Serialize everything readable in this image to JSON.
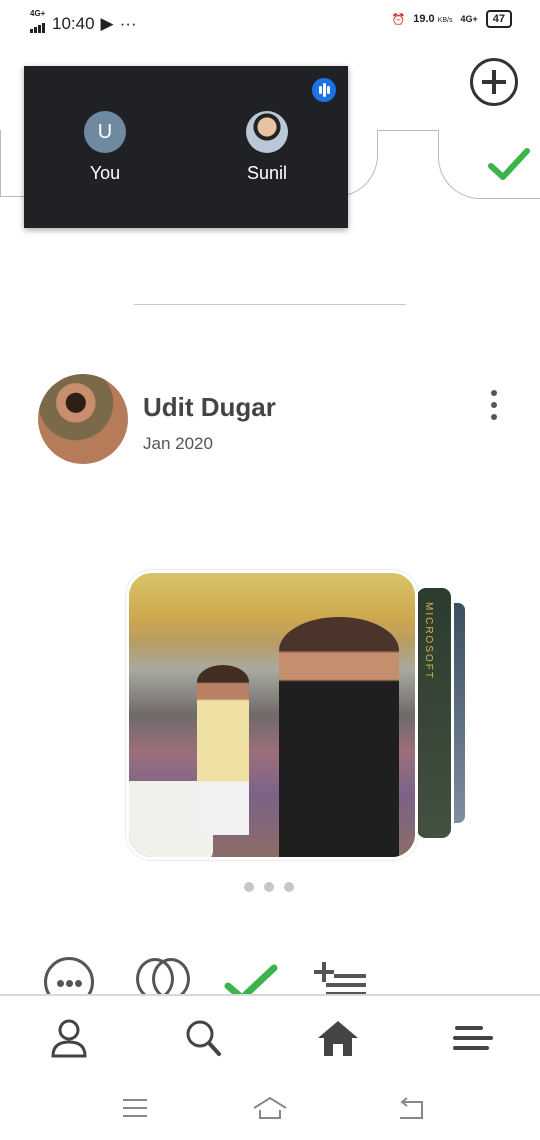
{
  "status_bar": {
    "network_left": "4G+",
    "time": "10:40",
    "speed": "19.0",
    "speed_unit": "KB/s",
    "network_right": "4G+",
    "battery": "47"
  },
  "call_overlay": {
    "participants": [
      {
        "initial": "U",
        "name": "You"
      },
      {
        "name": "Sunil"
      }
    ]
  },
  "post": {
    "author": "Udit Dugar",
    "date": "Jan 2020",
    "image_side_text": "MICROSOFT",
    "pager_dots": 3
  },
  "icons": {
    "add": "plus-circle-icon",
    "more": "kebab-menu-icon",
    "chat": "chat-bubble-icon",
    "like": "double-heart-icon",
    "done": "check-icon",
    "add_to_list": "playlist-add-icon",
    "profile": "person-icon",
    "search": "search-icon",
    "home": "home-icon",
    "menu": "menu-icon"
  },
  "colors": {
    "accent_green": "#3cb44b",
    "call_background": "#202124",
    "audio_blue": "#1a73e8"
  }
}
